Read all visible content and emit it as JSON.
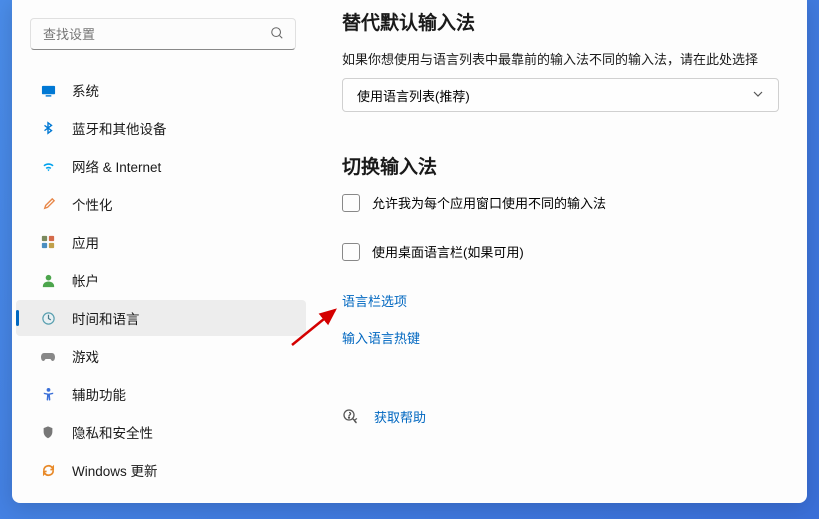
{
  "search": {
    "placeholder": "查找设置"
  },
  "sidebar": {
    "items": [
      {
        "label": "系统",
        "icon": "display",
        "color": "#0078d4"
      },
      {
        "label": "蓝牙和其他设备",
        "icon": "bluetooth",
        "color": "#0078d4"
      },
      {
        "label": "网络 & Internet",
        "icon": "wifi",
        "color": "#00a2ed"
      },
      {
        "label": "个性化",
        "icon": "brush",
        "color": "#e8884a"
      },
      {
        "label": "应用",
        "icon": "apps",
        "color": "#7b8a5e"
      },
      {
        "label": "帐户",
        "icon": "account",
        "color": "#4ca54c"
      },
      {
        "label": "时间和语言",
        "icon": "time",
        "color": "#5aa0b0"
      },
      {
        "label": "游戏",
        "icon": "game",
        "color": "#888"
      },
      {
        "label": "辅助功能",
        "icon": "access",
        "color": "#3a6fd8"
      },
      {
        "label": "隐私和安全性",
        "icon": "privacy",
        "color": "#777"
      },
      {
        "label": "Windows 更新",
        "icon": "update",
        "color": "#e88a2a"
      }
    ],
    "active_index": 6
  },
  "content": {
    "section1_title": "替代默认输入法",
    "section1_desc": "如果你想使用与语言列表中最靠前的输入法不同的输入法，请在此处选择",
    "dropdown_value": "使用语言列表(推荐)",
    "section2_title": "切换输入法",
    "checkbox1": "允许我为每个应用窗口使用不同的输入法",
    "checkbox2": "使用桌面语言栏(如果可用)",
    "link1": "语言栏选项",
    "link2": "输入语言热键",
    "help_label": "获取帮助"
  }
}
